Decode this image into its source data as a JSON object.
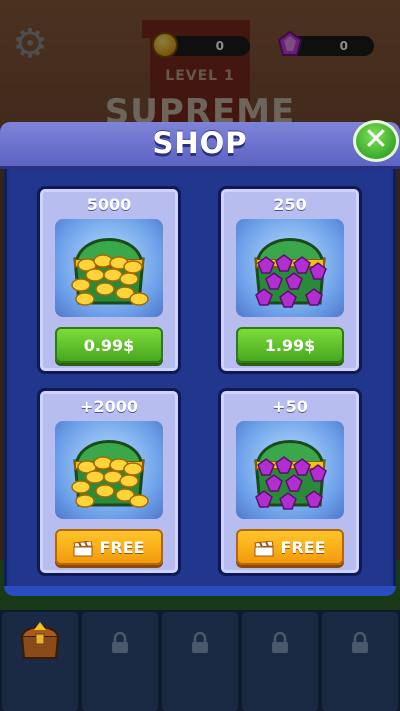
{
  "hud": {
    "coins": "0",
    "gems": "0",
    "level": "LEVEL 1",
    "background_title": "SUPREME"
  },
  "shop": {
    "title": "SHOP",
    "items": [
      {
        "amount": "5000",
        "reward": "coins",
        "button": "0.99$",
        "button_style": "green"
      },
      {
        "amount": "250",
        "reward": "gems",
        "button": "1.99$",
        "button_style": "green"
      },
      {
        "amount": "+2000",
        "reward": "coins",
        "button": "FREE",
        "button_style": "orange",
        "button_icon": "clapperboard-icon"
      },
      {
        "amount": "+50",
        "reward": "gems",
        "button": "FREE",
        "button_style": "orange",
        "button_icon": "clapperboard-icon"
      }
    ]
  },
  "colors": {
    "panel": "#1d3488",
    "header": "#6d73cd",
    "green_button": "#5cc22a",
    "orange_button": "#f7b21a",
    "close_button": "#3aa92a"
  },
  "bottom_bar": {
    "slots": [
      "chest-slot",
      "locked-slot",
      "locked-slot",
      "locked-slot",
      "locked-slot"
    ]
  }
}
